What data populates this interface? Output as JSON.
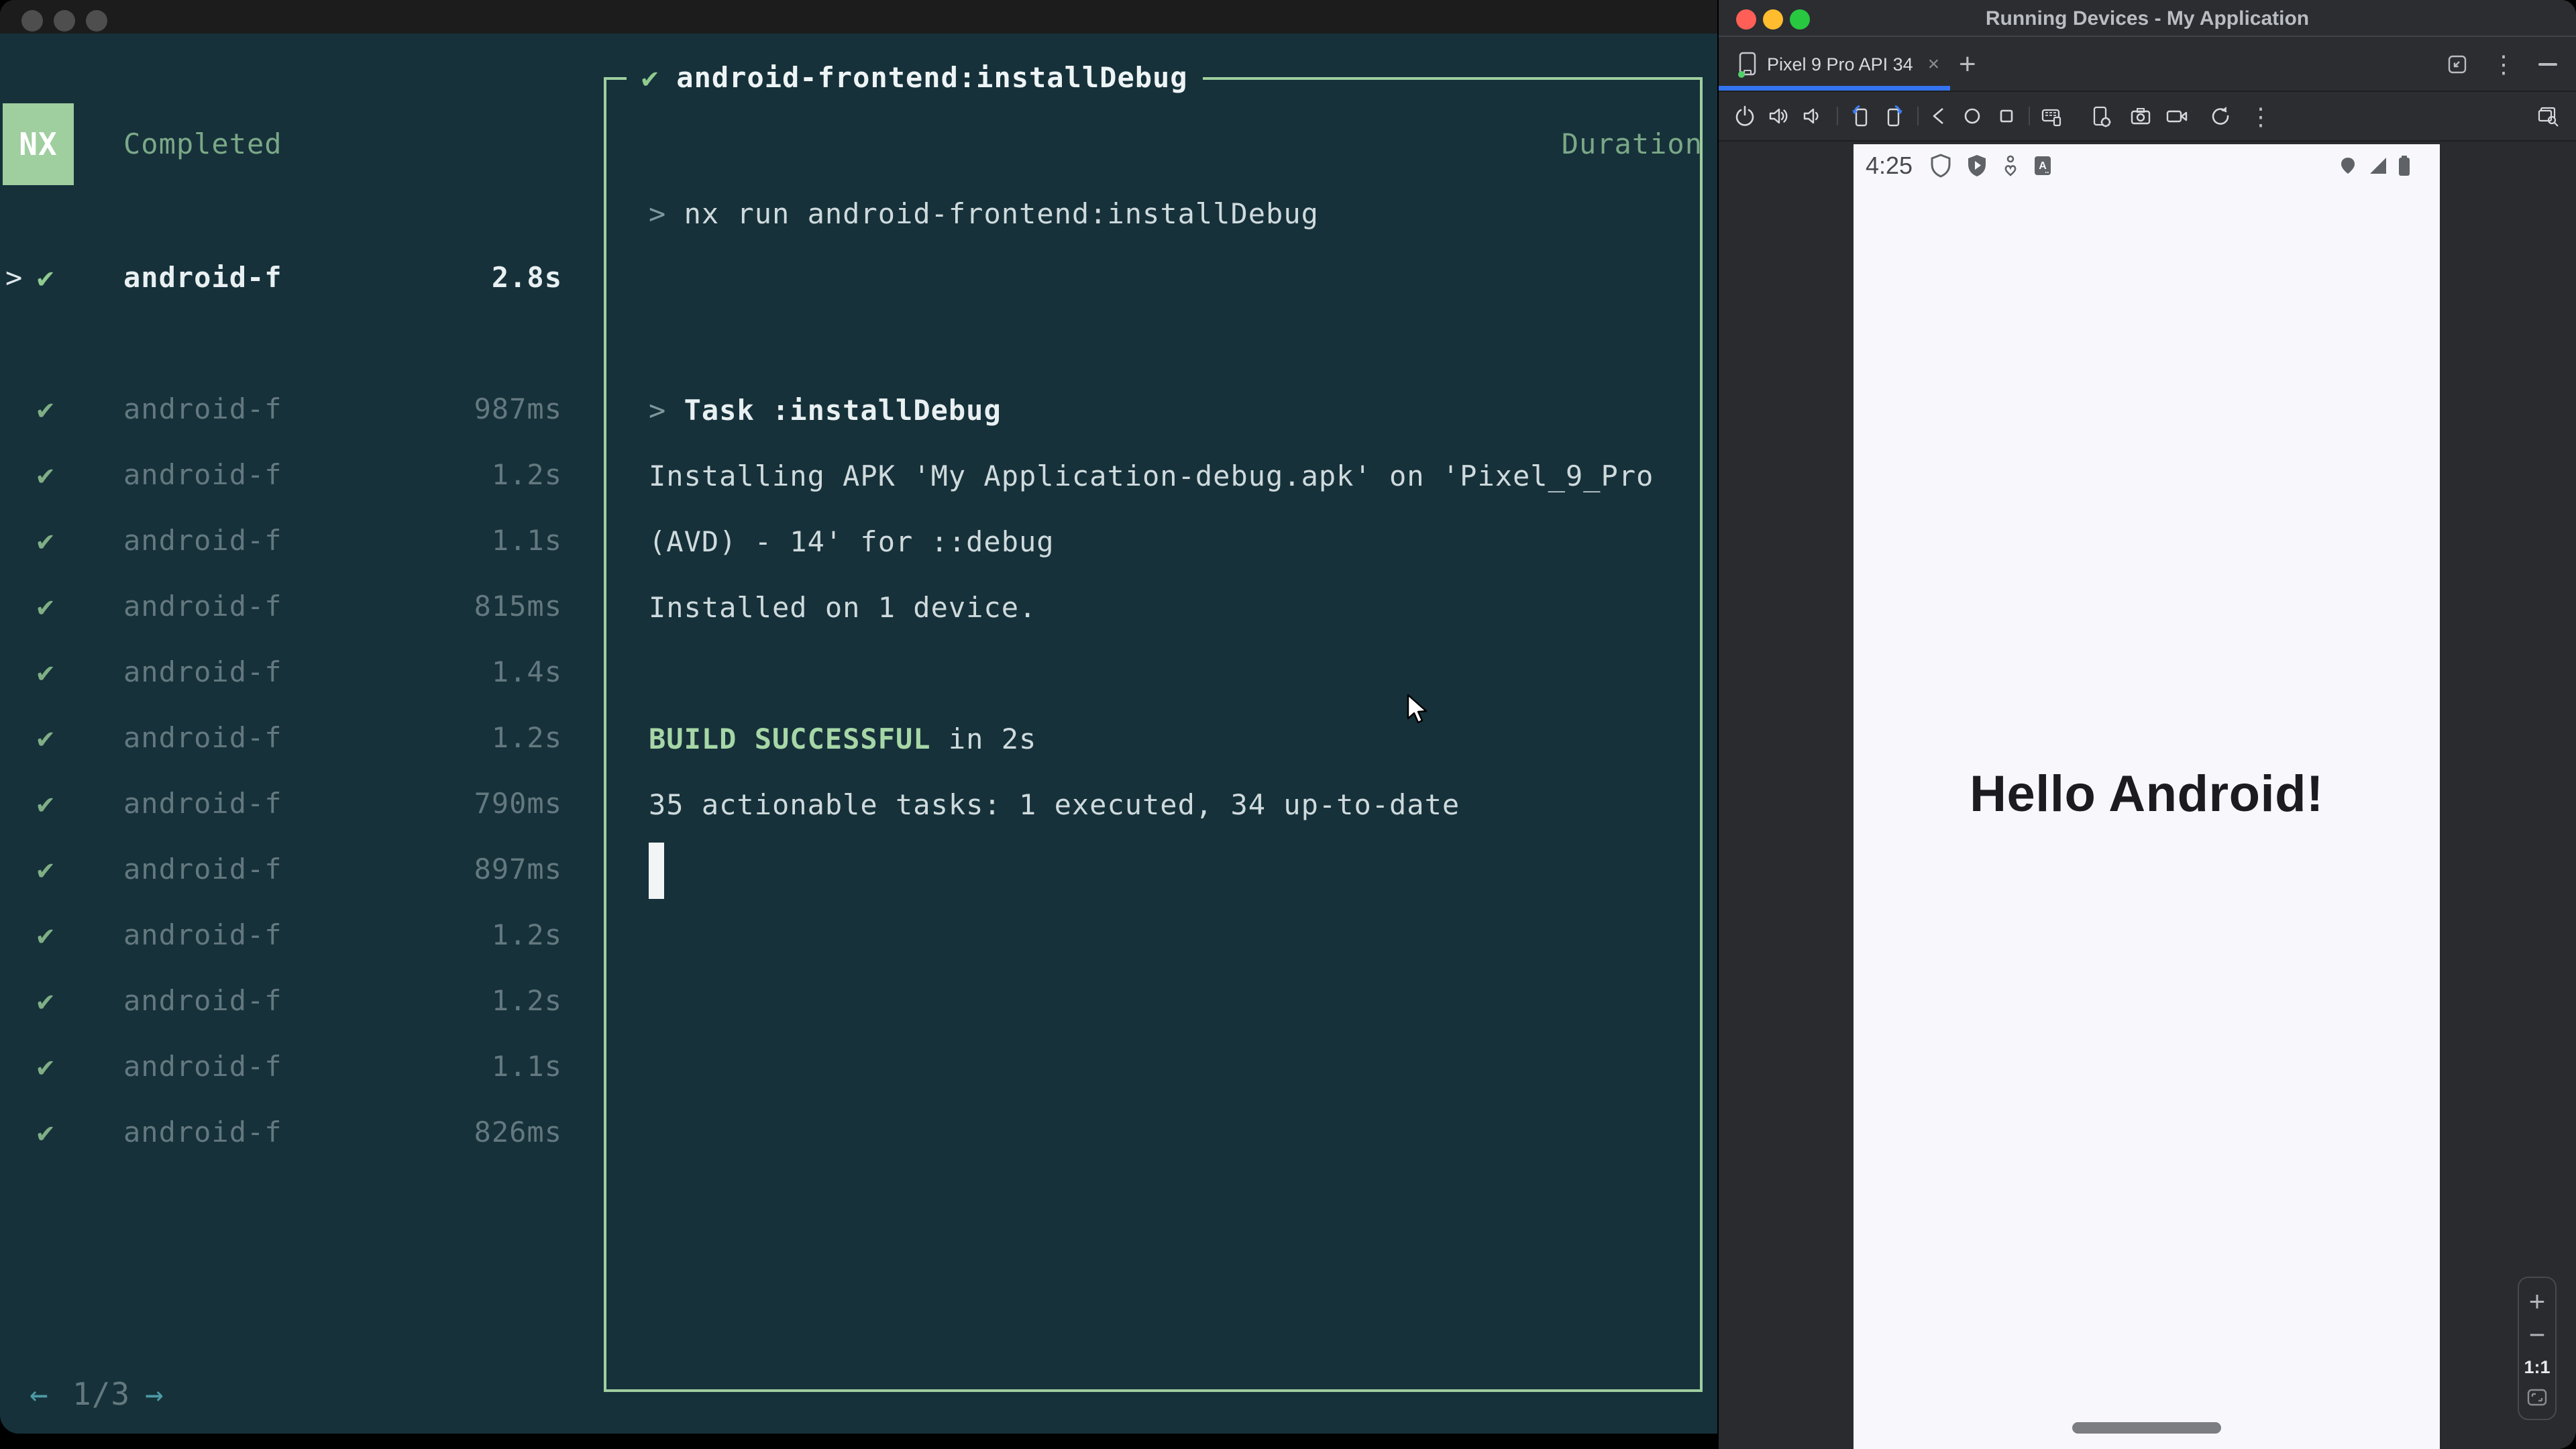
{
  "colors": {
    "accent_blue": "#3574f0",
    "nx_green": "#9fce9f",
    "success_green": "#a6d7a6",
    "terminal_bg": "#16313a",
    "traffic_red": "#ff5f57",
    "traffic_yellow": "#febc2e",
    "traffic_green": "#28c840"
  },
  "terminal": {
    "logo": "NX",
    "columns": {
      "completed": "Completed",
      "duration": "Duration"
    },
    "selected_task": {
      "chevron": ">",
      "check": "✔",
      "name": "android-f",
      "duration": "2.8s"
    },
    "tasks": [
      {
        "check": "✔",
        "name": "android-f",
        "duration": "987ms"
      },
      {
        "check": "✔",
        "name": "android-f",
        "duration": "1.2s"
      },
      {
        "check": "✔",
        "name": "android-f",
        "duration": "1.1s"
      },
      {
        "check": "✔",
        "name": "android-f",
        "duration": "815ms"
      },
      {
        "check": "✔",
        "name": "android-f",
        "duration": "1.4s"
      },
      {
        "check": "✔",
        "name": "android-f",
        "duration": "1.2s"
      },
      {
        "check": "✔",
        "name": "android-f",
        "duration": "790ms"
      },
      {
        "check": "✔",
        "name": "android-f",
        "duration": "897ms"
      },
      {
        "check": "✔",
        "name": "android-f",
        "duration": "1.2s"
      },
      {
        "check": "✔",
        "name": "android-f",
        "duration": "1.2s"
      },
      {
        "check": "✔",
        "name": "android-f",
        "duration": "1.1s"
      },
      {
        "check": "✔",
        "name": "android-f",
        "duration": "826ms"
      }
    ],
    "pagination": {
      "prev": "←",
      "label": "1/3",
      "next": "→"
    },
    "output": {
      "check": "✔",
      "title": "android-frontend:installDebug",
      "prompt": ">",
      "command": "nx run android-frontend:installDebug",
      "task_line": "Task :installDebug",
      "install_line_1": "Installing APK 'My Application-debug.apk' on 'Pixel_9_Pro",
      "install_line_2": "(AVD) - 14' for ::debug",
      "installed_line": "Installed on 1 device.",
      "build_status": "BUILD SUCCESSFUL",
      "build_suffix": "in 2s",
      "summary": "35 actionable tasks: 1 executed, 34 up-to-date"
    }
  },
  "studio": {
    "window_title": "Running Devices - My Application",
    "tab": {
      "label": "Pixel 9 Pro API 34",
      "close": "×",
      "new_tab": "+"
    },
    "toolbar_icons": [
      "power",
      "volume-up",
      "volume-down",
      "rotate-left",
      "rotate-right",
      "back",
      "home",
      "overview",
      "fold",
      "device-settings",
      "screenshot",
      "screen-record",
      "restart",
      "more",
      "inspect"
    ],
    "status_icons": [
      "shield-outline",
      "play-protect-shield",
      "wellbeing-person",
      "app-letter-badge",
      "location-pin",
      "signal-triangle",
      "battery"
    ],
    "emulator": {
      "time": "4:25",
      "app_badge_letter": "A",
      "hello_text": "Hello Android!",
      "zoom": {
        "zoom_in": "+",
        "zoom_out": "−",
        "actual_size": "1:1"
      }
    }
  }
}
